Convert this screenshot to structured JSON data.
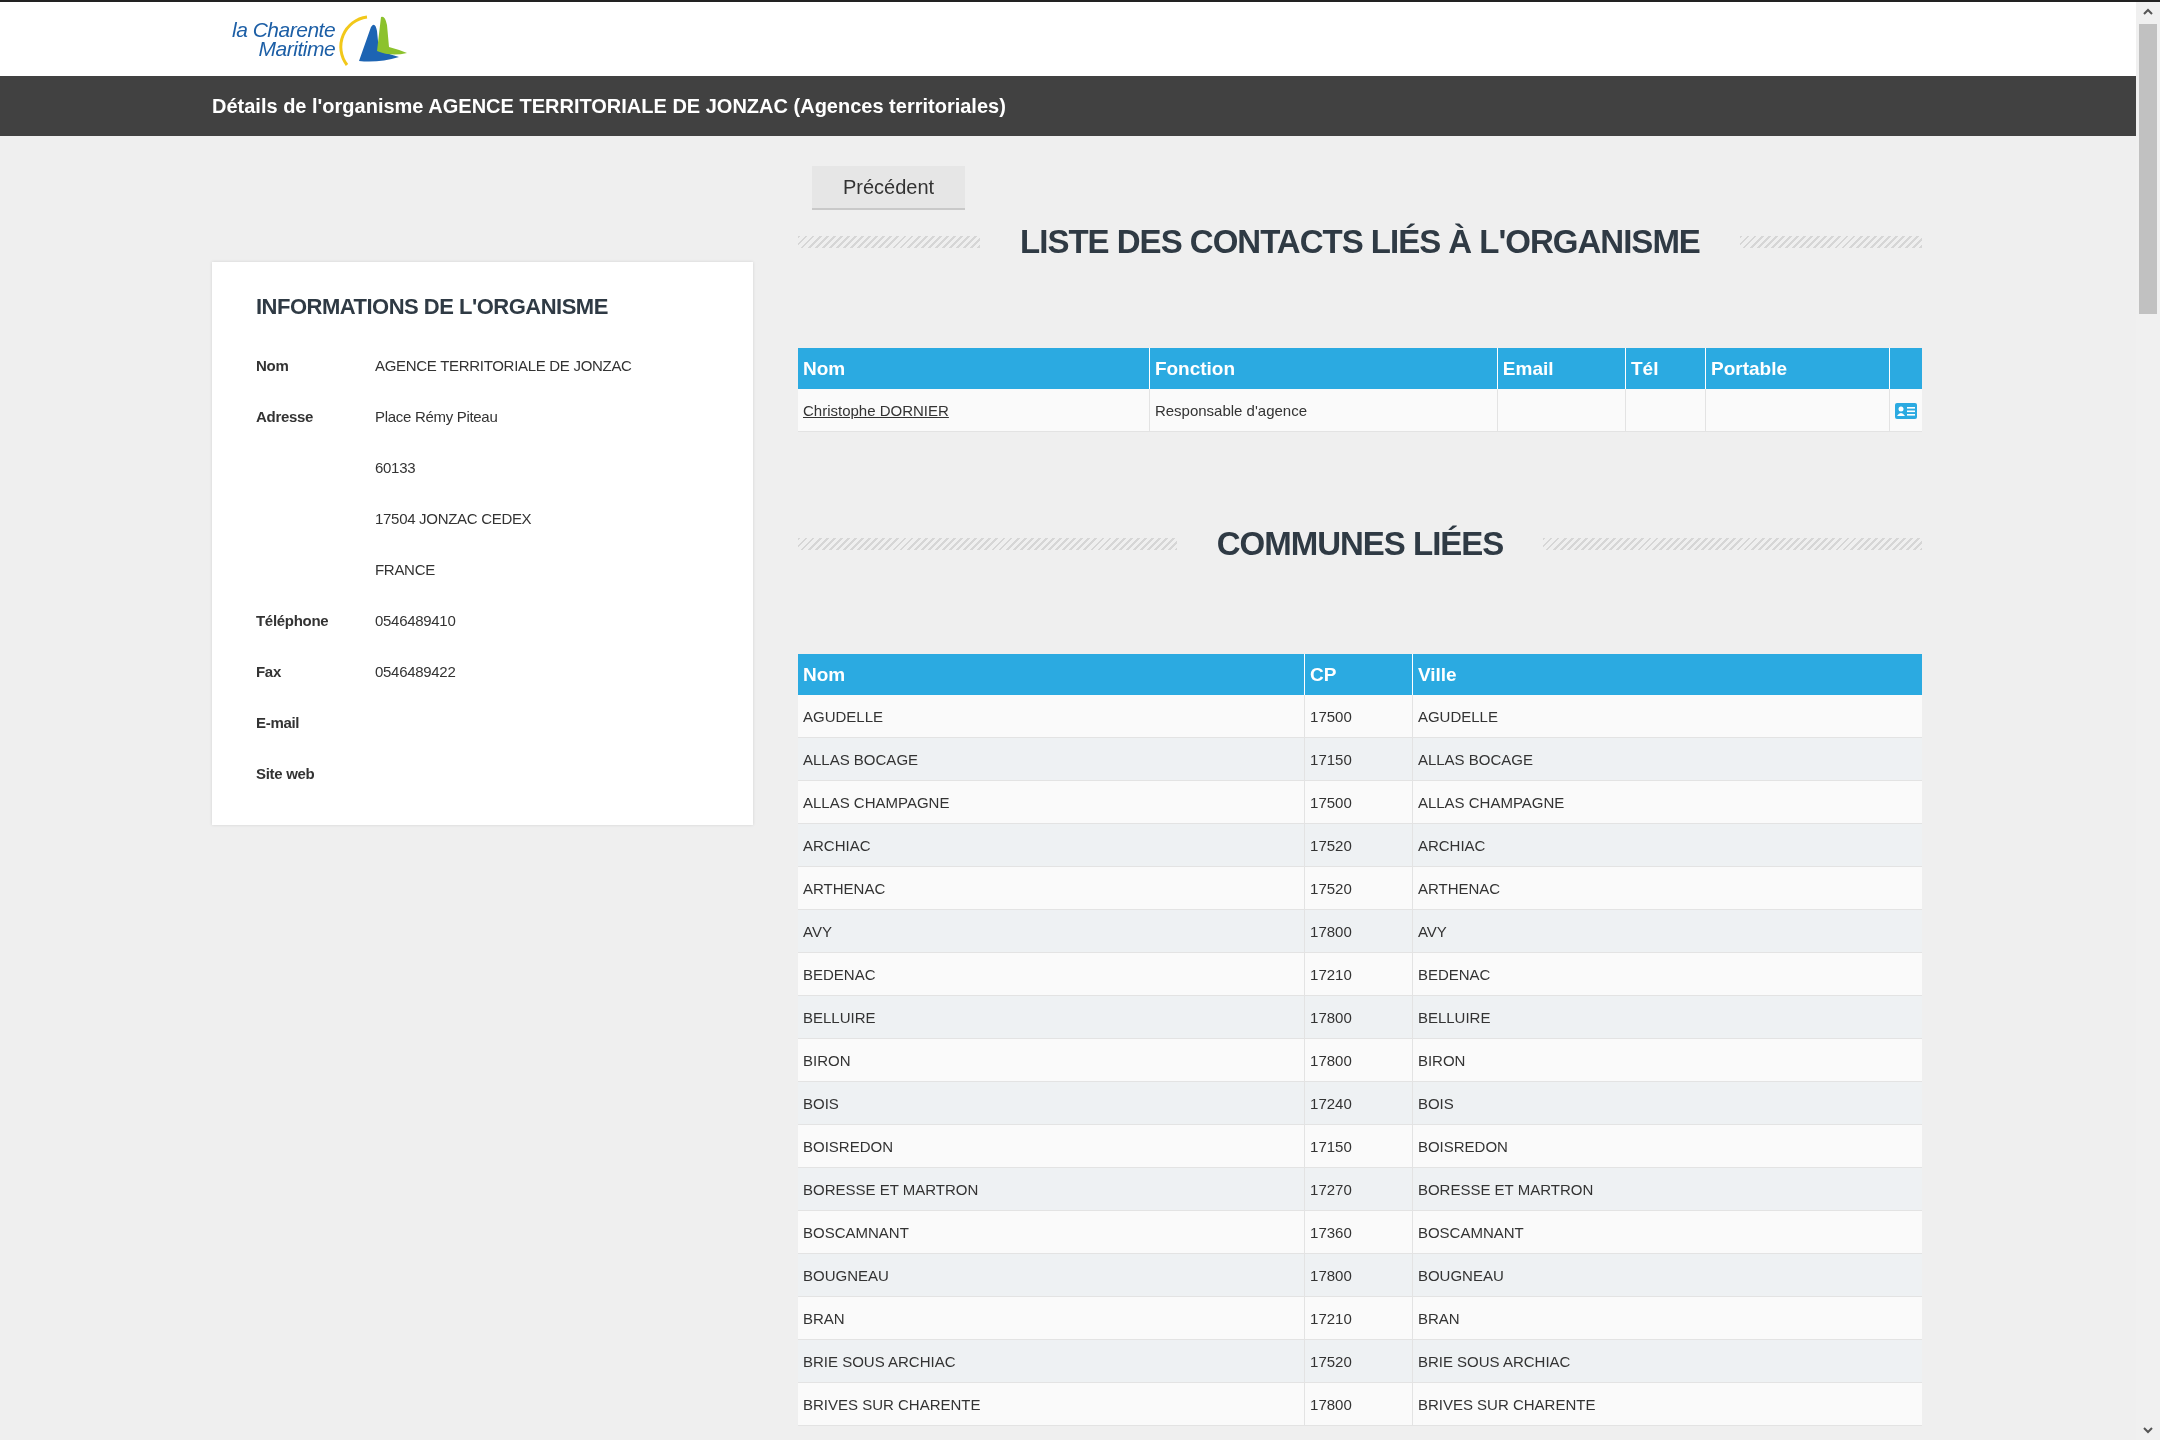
{
  "logo": {
    "lines": [
      "la Charente",
      "Maritime"
    ]
  },
  "title_bar": {
    "title": "Détails de l'organisme AGENCE TERRITORIALE DE JONZAC (Agences territoriales)"
  },
  "info_card": {
    "title": "INFORMATIONS DE L'ORGANISME",
    "fields": [
      {
        "label": "Nom",
        "value": "AGENCE TERRITORIALE DE JONZAC"
      },
      {
        "label": "Adresse",
        "value": "Place Rémy Piteau"
      },
      {
        "value": "60133"
      },
      {
        "value": "17504 JONZAC CEDEX"
      },
      {
        "value": "FRANCE"
      },
      {
        "label": "Téléphone",
        "value": "0546489410"
      },
      {
        "label": "Fax",
        "value": "0546489422"
      },
      {
        "label": "E-mail"
      },
      {
        "label": "Site web"
      }
    ]
  },
  "back_button": {
    "label": "Précédent"
  },
  "contacts": {
    "title": "LISTE DES CONTACTS LIÉS À L'ORGANISME",
    "columns": [
      "Nom",
      "Fonction",
      "Email",
      "Tél",
      "Portable"
    ],
    "rows": [
      {
        "name": "Christophe DORNIER",
        "function": "Responsable d'agence"
      }
    ]
  },
  "communes": {
    "title": "COMMUNES LIÉES",
    "columns": [
      "Nom",
      "CP",
      "Ville"
    ],
    "rows": [
      [
        "AGUDELLE",
        "17500",
        "AGUDELLE"
      ],
      [
        "ALLAS BOCAGE",
        "17150",
        "ALLAS BOCAGE"
      ],
      [
        "ALLAS CHAMPAGNE",
        "17500",
        "ALLAS CHAMPAGNE"
      ],
      [
        "ARCHIAC",
        "17520",
        "ARCHIAC"
      ],
      [
        "ARTHENAC",
        "17520",
        "ARTHENAC"
      ],
      [
        "AVY",
        "17800",
        "AVY"
      ],
      [
        "BEDENAC",
        "17210",
        "BEDENAC"
      ],
      [
        "BELLUIRE",
        "17800",
        "BELLUIRE"
      ],
      [
        "BIRON",
        "17800",
        "BIRON"
      ],
      [
        "BOIS",
        "17240",
        "BOIS"
      ],
      [
        "BOISREDON",
        "17150",
        "BOISREDON"
      ],
      [
        "BORESSE ET MARTRON",
        "17270",
        "BORESSE ET MARTRON"
      ],
      [
        "BOSCAMNANT",
        "17360",
        "BOSCAMNANT"
      ],
      [
        "BOUGNEAU",
        "17800",
        "BOUGNEAU"
      ],
      [
        "BRAN",
        "17210",
        "BRAN"
      ],
      [
        "BRIE SOUS ARCHIAC",
        "17520",
        "BRIE SOUS ARCHIAC"
      ],
      [
        "BRIVES SUR CHARENTE",
        "17800",
        "BRIVES SUR CHARENTE"
      ]
    ]
  }
}
